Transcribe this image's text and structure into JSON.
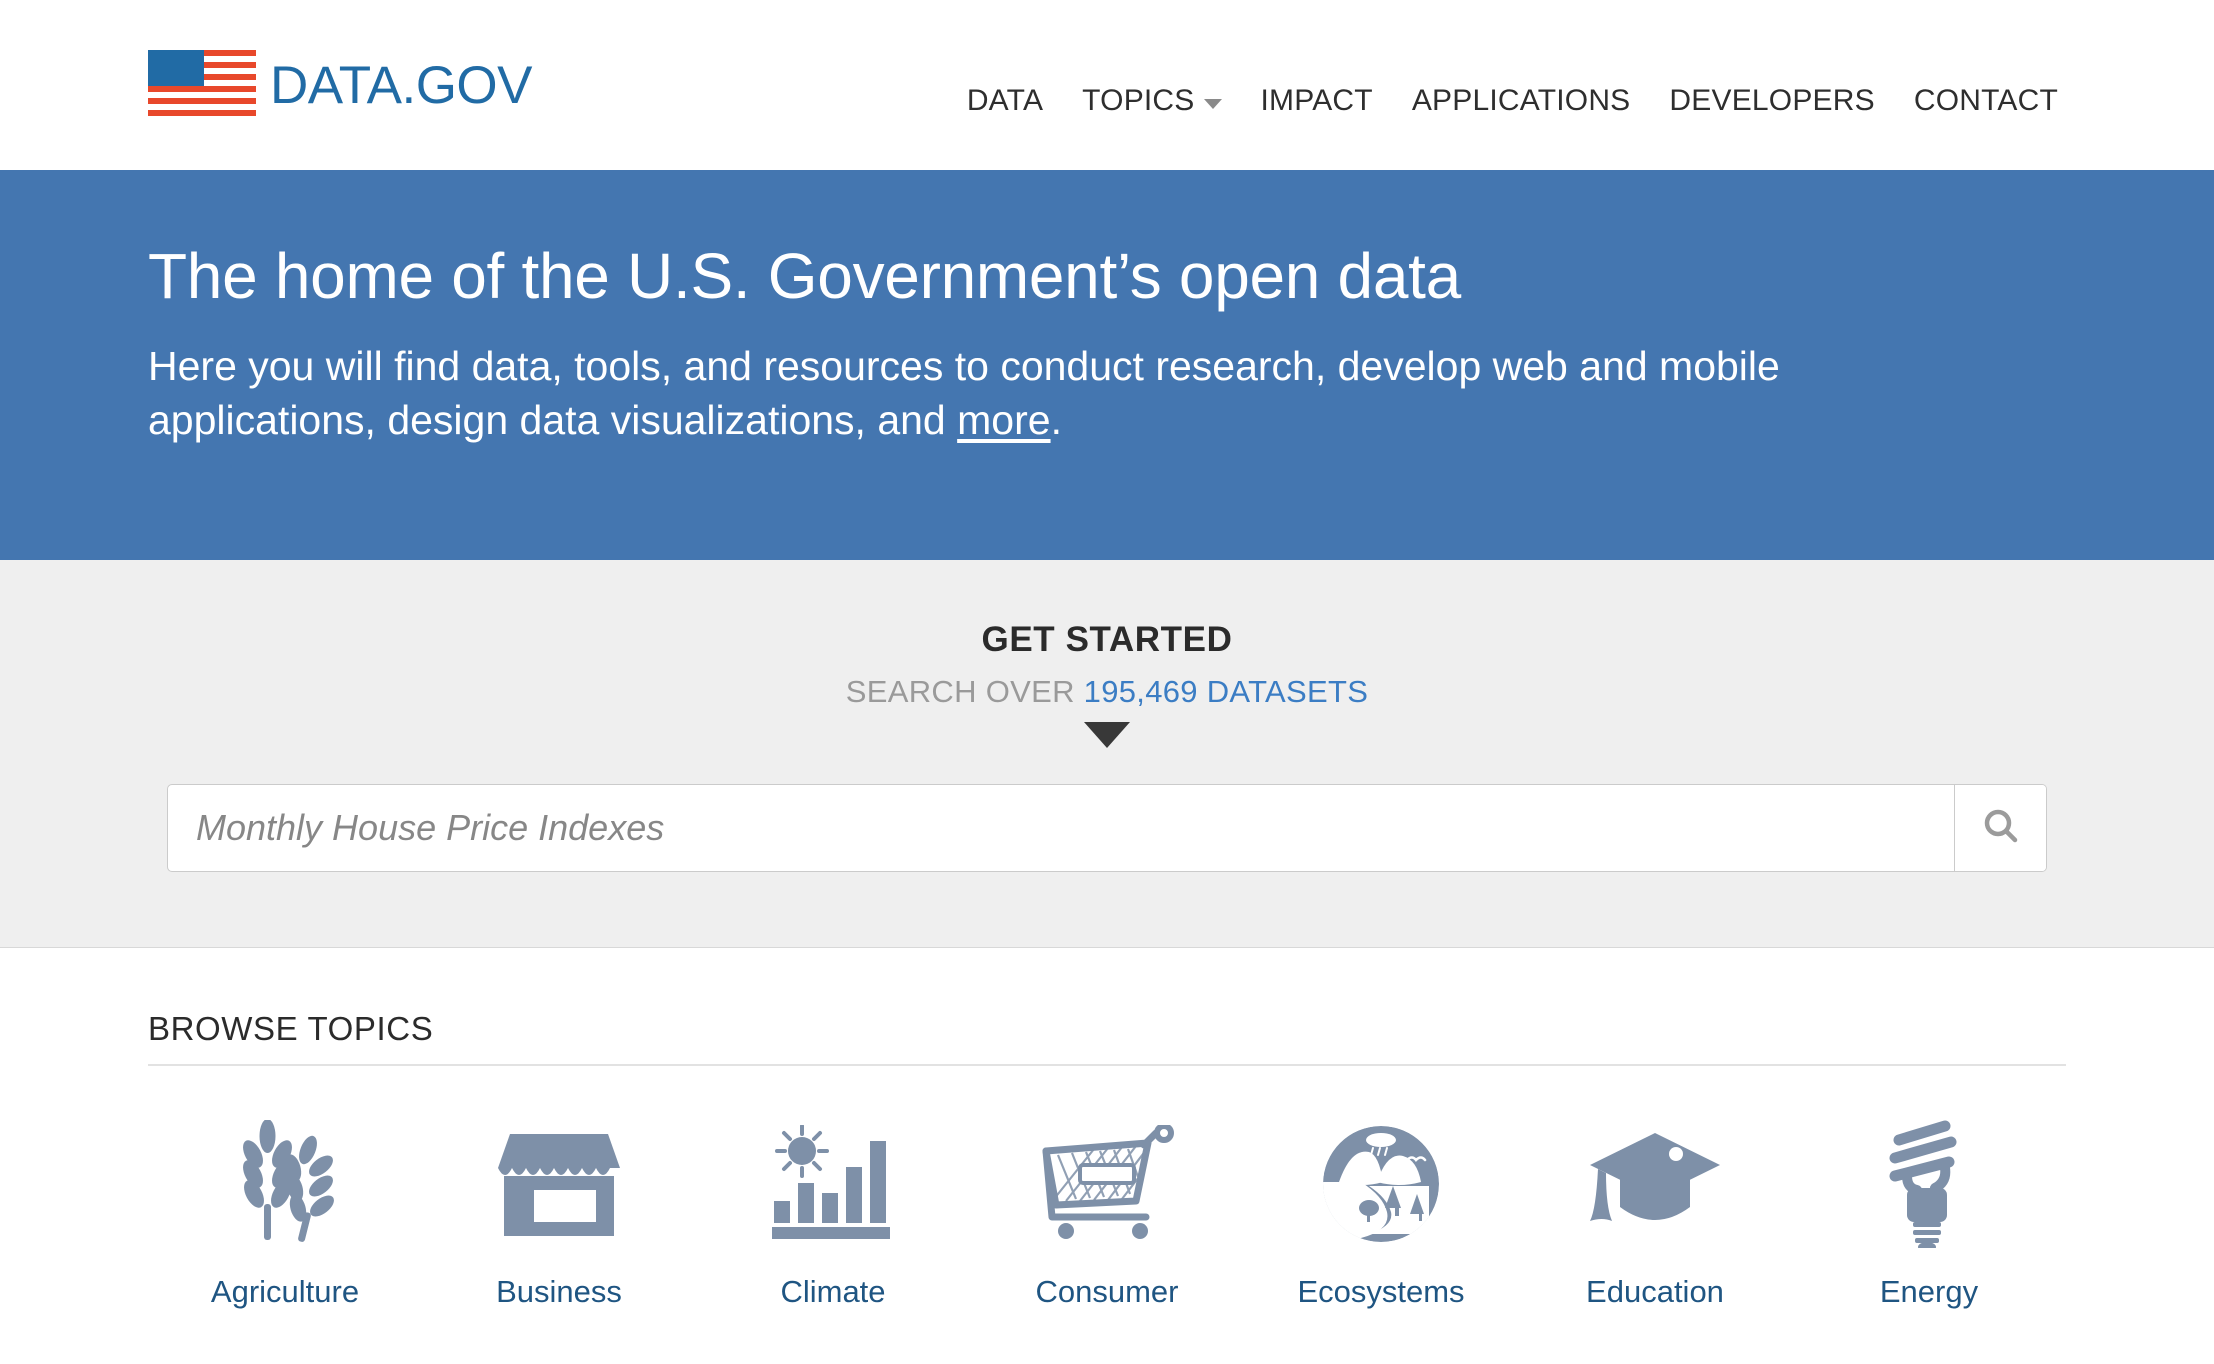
{
  "site": {
    "brand_name": "DATA.GOV",
    "flag_icon": "us-flag-icon"
  },
  "nav": {
    "items": [
      {
        "label": "DATA",
        "has_dropdown": false
      },
      {
        "label": "TOPICS",
        "has_dropdown": true
      },
      {
        "label": "IMPACT",
        "has_dropdown": false
      },
      {
        "label": "APPLICATIONS",
        "has_dropdown": false
      },
      {
        "label": "DEVELOPERS",
        "has_dropdown": false
      },
      {
        "label": "CONTACT",
        "has_dropdown": false
      }
    ]
  },
  "hero": {
    "title": "The home of the U.S. Government’s open data",
    "description_part1": "Here you will find data, tools, and resources to conduct research, develop web and mobile applications, design data visualizations, and ",
    "more_link": "more",
    "description_part2": ".",
    "background_color": "#4476b0"
  },
  "search": {
    "heading": "GET STARTED",
    "subheading_prefix": "SEARCH OVER ",
    "dataset_count": "195,469 DATASETS",
    "placeholder": "Monthly House Price Indexes",
    "value": "",
    "submit_icon": "search-icon",
    "arrow_icon": "triangle-down-icon",
    "count_color": "#3b7dc4"
  },
  "browse": {
    "title": "BROWSE TOPICS",
    "topics": [
      {
        "label": "Agriculture",
        "icon": "wheat-icon"
      },
      {
        "label": "Business",
        "icon": "storefront-icon"
      },
      {
        "label": "Climate",
        "icon": "sun-barchart-icon"
      },
      {
        "label": "Consumer",
        "icon": "shopping-cart-icon"
      },
      {
        "label": "Ecosystems",
        "icon": "landscape-circle-icon"
      },
      {
        "label": "Education",
        "icon": "graduation-cap-icon"
      },
      {
        "label": "Energy",
        "icon": "cfl-bulb-icon"
      }
    ],
    "icon_color": "#7e90a8",
    "label_color": "#1f5582"
  }
}
